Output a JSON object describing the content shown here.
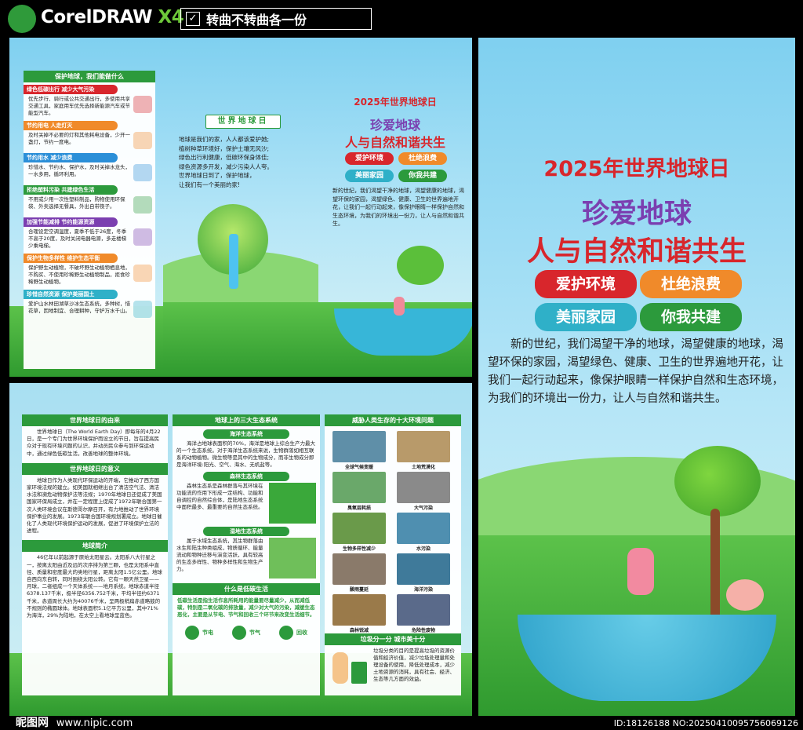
{
  "header": {
    "app_logo": "CorelDRAW",
    "app_version": "X4",
    "note": "转曲不转曲各一份"
  },
  "colors": {
    "green": "#2c9a3c",
    "red": "#d8262c",
    "blue": "#2b8fd8",
    "orange": "#f08a2a",
    "teal": "#2fb0c8",
    "purple": "#7b3fb0",
    "sky": "#9fdcf3"
  },
  "front": {
    "title": "2025年世界地球日",
    "slogan1": "珍爱地球",
    "slogan2": "人与自然和谐共生",
    "pills": [
      "爱护环境",
      "杜绝浪费",
      "美丽家园",
      "你我共建"
    ],
    "intro": "新的世纪，我们渴望干净的地球，渴望健康的地球，渴望环保的家园，渴望绿色、健康、卫生的世界遍地开花，让我们一起行动起来，像保护眼睛一样保护自然和生态环境，为我们的环境出一份力，让人与自然和谐共生。"
  },
  "left": {
    "title": "保护地球，我们能做什么",
    "items": [
      {
        "h": "绿色低碳出行 减少大气污染",
        "t": "优先步行、骑行或公共交通出行，多使用共享交通工具，家庭用车优先选择新能源汽车或节能型汽车。",
        "c": "#d8262c"
      },
      {
        "h": "节约用电 人走灯灭",
        "t": "及时关掉不必要的灯和其他耗电设备，少开一盏灯，节约一度电。",
        "c": "#f08a2a"
      },
      {
        "h": "节约用水 减少浪费",
        "t": "珍惜水、节约水、保护水，及时关掉水龙头，一水多用，循环利用。",
        "c": "#2b8fd8"
      },
      {
        "h": "拒绝塑料污染 共建绿色生活",
        "t": "不用或少用一次性塑料制品，购物使用环保袋、外卖选择无餐具，外出自带筷子。",
        "c": "#2c9a3c"
      },
      {
        "h": "加强节能减排 节约能源资源",
        "t": "合理设定空调温度，夏季不低于26度，冬季不高于20度，及时关闭电器电源，多走楼梯少乘电梯。",
        "c": "#7b3fb0"
      },
      {
        "h": "保护生物多样性 维护生态平衡",
        "t": "保护野生动植物，不破坏野生动植物栖息地，不购买、不使用珍稀野生动植物制品，拒食珍稀野生动植物。",
        "c": "#f08a2a"
      },
      {
        "h": "珍惜自然资源 保护美丽国土",
        "t": "爱护山水林田湖草沙冰生态系统，多种树，惜花草，因地制宜、合理耕种，守护万水千山。",
        "c": "#2fb0c8"
      }
    ]
  },
  "mid": {
    "badge": "世界地球日",
    "poem": [
      "地球是我们的家，人人都该爱护她;",
      "植树种草环境好，保护土壤无风沙;",
      "绿色出行利健康，低碳环保身体佳;",
      "绿色资源多开发，减少污染人人夸。",
      "世界地球日到了，保护地球，",
      "让我们有一个美丽的家!"
    ]
  },
  "fold": {
    "title": "2025年世界地球日",
    "slogan1": "珍爱地球",
    "slogan2": "人与自然和谐共生",
    "pills": [
      "爱护环境",
      "杜绝浪费",
      "美丽家园",
      "你我共建"
    ],
    "intro": "新的世纪，我们渴望干净的地球，渴望健康的地球，渴望环保的家园，渴望绿色、健康、卫生的世界遍地开花，让我们一起行动起来，像保护眼睛一样保护自然和生态环境，为我们的环境出一份力，让人与自然和谐共生。"
  },
  "inner": {
    "col1": [
      {
        "h": "世界地球日的由来",
        "t": "世界地球日（The World Earth Day）即每年的4月22日，是一个专门为世界环境保护而设立的节日，旨在提高民众对于现有环境问题的认识，并动员民众参与到环保运动中，通过绿色低碳生活，改善地球的整体环境。"
      },
      {
        "h": "世界地球日的意义",
        "t": "地球日作为人类现代环保运动的开端，它推动了西方国家环境法规的建立。如美国就相继出台了清洁空气法、清洁水法和濒危动物保护法等法规；1970年地球日还促成了美国国家环保局成立，并在一定程度上促成了1972年联合国第一次人类环境会议在斯德哥尔摩召开，有力地推动了世界环境保护事业的发展。1973年联合国环境规划署成立。地球日催化了人类现代环境保护运动的发展，促进了环境保护立法的进程。"
      },
      {
        "h": "地球简介",
        "t": "46亿年以前起源于原始太阳星云。太阳系八大行星之一，按离太阳由近及远的次序排为第三颗，也是太阳系中直径、质量和密度最大的类地行星，距离太阳1.5亿公里。地球自西向东自转，同时围绕太阳公转。它有一颗天然卫星——月球，二者组成一个天体系统——地月系统。地球赤道半径6378.137千米，极半径6356.752千米，平均半径约6371千米，赤道周长大约为40076千米，呈两极稍扁赤道略鼓的不规则的椭圆球体。地球表面积5.1亿平方公里，其中71%为海洋，29%为陆地，在太空上看地球呈蓝色。"
      }
    ],
    "col2_title": "地球上的三大生态系统",
    "eco": [
      {
        "h": "海洋生态系统",
        "t": "海洋占地球表面积的70%，海洋是地球上综合生产力最大的一个生态系统。对于海洋生态系统来说，生物群落如相互联系的动物植物。微生物等是其中的生物成分，而非生物成分即是海洋环境:阳光、空气、海水、无机盐等。"
      },
      {
        "h": "森林生态系统",
        "t": "森林生态系是森林群落与其环境在功能流的作用下形成一定结构、功能和自调控的自然综合体，是陆地生态系统中面积最多、最重要的自然生态系统。"
      },
      {
        "h": "湿地生态系统",
        "t": "属于水域生态系统，其生物群落由水生和陆生种类组成，物质循环、能量流动和物种迁移与演变活跃，具有较高的生态多样性、物种多样性和生物生产力。"
      }
    ],
    "lowcarbon": {
      "h": "什么是低碳生活",
      "t": "低碳生活是指生活作息所耗用的能量要尽量减少，从而减低碳，特别是二氧化碳的排放量，减少对大气的污染，减缓生态恶化，主要是从节电、节气和回收三个环节来改变生活细节。",
      "labels": [
        "节电",
        "节气",
        "回收"
      ]
    },
    "col3_title": "威胁人类生存的十大环境问题",
    "problems": [
      "全球气候变暖",
      "土地荒漠化",
      "臭氧层耗损",
      "大气污染",
      "生物多样性减少",
      "水污染",
      "酸雨蔓延",
      "海洋污染",
      "森林锐减",
      "危险性废物"
    ],
    "garbage": {
      "h": "垃圾分一分 城市美十分",
      "t": "垃圾分类的目的是提高垃圾的资源价值和经济价值，减少垃圾处理量和处理设备的使用，降低处理成本，减少土地资源的消耗，具有社会、经济、生态等几方面的效益。"
    }
  },
  "footer": {
    "site": "昵图网",
    "url": "www.nipic.com",
    "id": "ID:18126188 NO:20250410095756069126"
  }
}
